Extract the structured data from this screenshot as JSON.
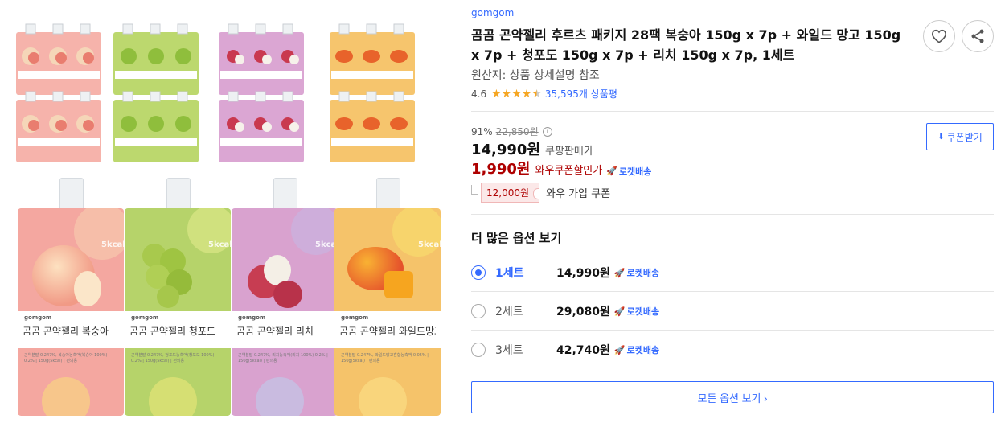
{
  "product": {
    "brand": "gomgom",
    "title": "곰곰 곤약젤리 후르츠 패키지 28팩 복숭아 150g x 7p + 와일드 망고 150g x 7p + 청포도 150g x 7p + 리치 150g x 7p, 1세트",
    "origin": "원산지: 상품 상세설명 참조",
    "rating": "4.6",
    "rating_stars": 4.5,
    "review_count": "35,595개 상품평",
    "image_alt": "곰곰 곤약젤리 4종 파우치"
  },
  "packaging": {
    "pouch_brand": "gomgom",
    "pouch_kcal": "5kcal",
    "peach_label": "곰곰 곤약젤리 복숭아",
    "grape_label": "곰곰 곤약젤리 청포도",
    "lychee_label": "곰곰 곤약젤리 리치",
    "mango_label": "곰곰 곤약젤리 와일드망고",
    "peach_small": "곤약분말 0.247%, 복숭아농축액(복숭아 100%) 0.2% | 150g(5kcal) | 편의용",
    "grape_small": "곤약분말 0.247%, 청포도농축액(청포도 100%) 0.2% | 150g(5kcal) | 편의용",
    "lychee_small": "곤약분말 0.247%, 리치농축액(리치 100%) 0.2% | 150g(5kcal) | 편의용",
    "mango_small": "곤약분말 0.247%, 와일드망고혼합농축액 0.05% | 150g(5kcal) | 편의용"
  },
  "pricing": {
    "discount_rate": "91%",
    "original_price": "22,850원",
    "sale_price": "14,990원",
    "sale_label": "쿠팡판매가",
    "wow_price": "1,990원",
    "wow_label": "와우쿠폰할인가",
    "rocket_label": "로켓배송",
    "coupon_amount": "12,000원",
    "coupon_desc": "와우 가입 쿠폰",
    "coupon_button": "쿠폰받기"
  },
  "options": {
    "title": "더 많은 옵션 보기",
    "items": [
      {
        "name": "1세트",
        "price": "14,990원",
        "delivery": "로켓배송",
        "selected": true
      },
      {
        "name": "2세트",
        "price": "29,080원",
        "delivery": "로켓배송",
        "selected": false
      },
      {
        "name": "3세트",
        "price": "42,740원",
        "delivery": "로켓배송",
        "selected": false
      }
    ],
    "all_button": "모든 옵션 보기 ›"
  },
  "colors": {
    "accent": "#346aff",
    "wow": "#ae0000",
    "star": "#f5a623",
    "peach": "#f4a7a0",
    "grape": "#b6d36a",
    "lychee": "#d9a2cf",
    "mango": "#f5c36a"
  },
  "icons": {
    "wishlist": "heart-icon",
    "share": "share-icon",
    "rocket": "rocket-icon",
    "download": "download-icon",
    "info": "info-icon"
  }
}
